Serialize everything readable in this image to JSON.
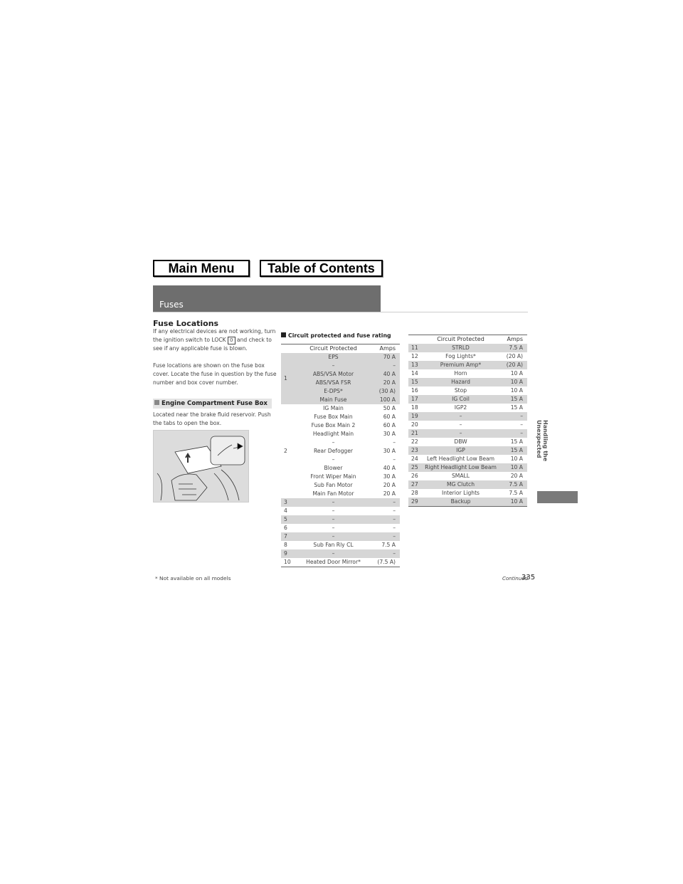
{
  "nav": {
    "main_menu": "Main Menu",
    "toc": "Table of Contents"
  },
  "header": {
    "title": "Fuses"
  },
  "section": {
    "title": "Fuse Locations",
    "para1_a": "If any electrical devices are not working, turn the ignition switch to LOCK",
    "lock_key": "0",
    "para1_b": "and check to see if any applicable fuse is blown.",
    "para2": "Fuse locations are shown on the fuse box cover. Locate the fuse in question by the fuse number and box cover number.",
    "subheading": "Engine Compartment Fuse Box",
    "para3": "Located near the brake fluid reservoir. Push the tabs to open the box."
  },
  "table_title": "Circuit protected and fuse rating",
  "columns": {
    "circuit": "Circuit Protected",
    "amps": "Amps"
  },
  "left_table": [
    {
      "no": "1",
      "shaded": true,
      "items": [
        [
          "EPS",
          "70 A"
        ],
        [
          "–",
          "–"
        ],
        [
          "ABS/VSA Motor",
          "40 A"
        ],
        [
          "ABS/VSA FSR",
          "20 A"
        ],
        [
          "E-DPS*",
          "(30 A)"
        ],
        [
          "Main Fuse",
          "100 A"
        ]
      ]
    },
    {
      "no": "2",
      "shaded": false,
      "items": [
        [
          "IG Main",
          "50 A"
        ],
        [
          "Fuse Box Main",
          "60 A"
        ],
        [
          "Fuse Box Main 2",
          "60 A"
        ],
        [
          "Headlight Main",
          "30 A"
        ],
        [
          "–",
          "–"
        ],
        [
          "Rear Defogger",
          "30 A"
        ],
        [
          "–",
          "–"
        ],
        [
          "Blower",
          "40 A"
        ],
        [
          "Front Wiper Main",
          "30 A"
        ],
        [
          "Sub Fan Motor",
          "20 A"
        ],
        [
          "Main Fan Motor",
          "20 A"
        ]
      ]
    },
    {
      "no": "3",
      "shaded": true,
      "items": [
        [
          "–",
          "–"
        ]
      ]
    },
    {
      "no": "4",
      "shaded": false,
      "items": [
        [
          "–",
          "–"
        ]
      ]
    },
    {
      "no": "5",
      "shaded": true,
      "items": [
        [
          "–",
          "–"
        ]
      ]
    },
    {
      "no": "6",
      "shaded": false,
      "items": [
        [
          "–",
          "–"
        ]
      ]
    },
    {
      "no": "7",
      "shaded": true,
      "items": [
        [
          "–",
          "–"
        ]
      ]
    },
    {
      "no": "8",
      "shaded": false,
      "items": [
        [
          "Sub Fan Rly CL",
          "7.5 A"
        ]
      ]
    },
    {
      "no": "9",
      "shaded": true,
      "items": [
        [
          "–",
          "–"
        ]
      ]
    },
    {
      "no": "10",
      "shaded": false,
      "items": [
        [
          "Heated Door Mirror*",
          "(7.5 A)"
        ]
      ]
    }
  ],
  "right_table": [
    [
      "11",
      "STRLD",
      "7.5 A"
    ],
    [
      "12",
      "Fog Lights*",
      "(20 A)"
    ],
    [
      "13",
      "Premium Amp*",
      "(20 A)"
    ],
    [
      "14",
      "Horn",
      "10 A"
    ],
    [
      "15",
      "Hazard",
      "10 A"
    ],
    [
      "16",
      "Stop",
      "10 A"
    ],
    [
      "17",
      "IG Coil",
      "15 A"
    ],
    [
      "18",
      "IGP2",
      "15 A"
    ],
    [
      "19",
      "–",
      "–"
    ],
    [
      "20",
      "–",
      "–"
    ],
    [
      "21",
      "–",
      "–"
    ],
    [
      "22",
      "DBW",
      "15 A"
    ],
    [
      "23",
      "IGP",
      "15 A"
    ],
    [
      "24",
      "Left Headlight Low Beam",
      "10 A"
    ],
    [
      "25",
      "Right Headlight Low Beam",
      "10 A"
    ],
    [
      "26",
      "SMALL",
      "20 A"
    ],
    [
      "27",
      "MG Clutch",
      "7.5 A"
    ],
    [
      "28",
      "Interior Lights",
      "7.5 A"
    ],
    [
      "29",
      "Backup",
      "10 A"
    ]
  ],
  "side_tab": "Handling the Unexpected",
  "footer": {
    "note": "* Not available on all models",
    "continued": "Continued",
    "page": "335"
  }
}
